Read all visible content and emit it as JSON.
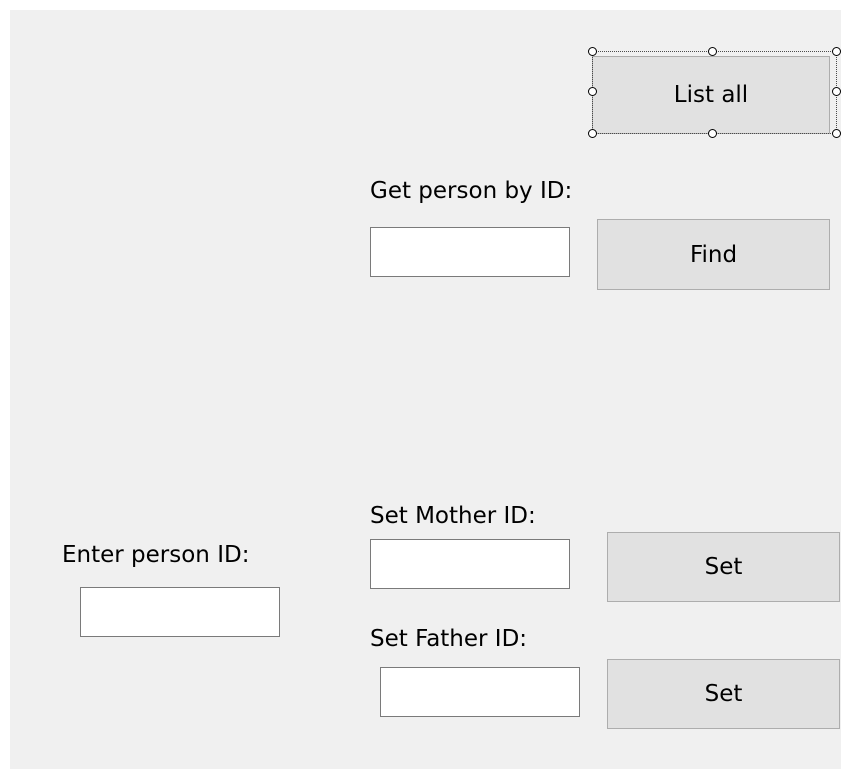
{
  "list_all": {
    "label": "List all"
  },
  "get_person": {
    "label": "Get person by ID:",
    "input_value": "",
    "find_label": "Find"
  },
  "enter_person": {
    "label": "Enter person ID:",
    "input_value": ""
  },
  "set_mother": {
    "label": "Set Mother ID:",
    "input_value": "",
    "button_label": "Set"
  },
  "set_father": {
    "label": "Set Father ID:",
    "input_value": "",
    "button_label": "Set"
  }
}
